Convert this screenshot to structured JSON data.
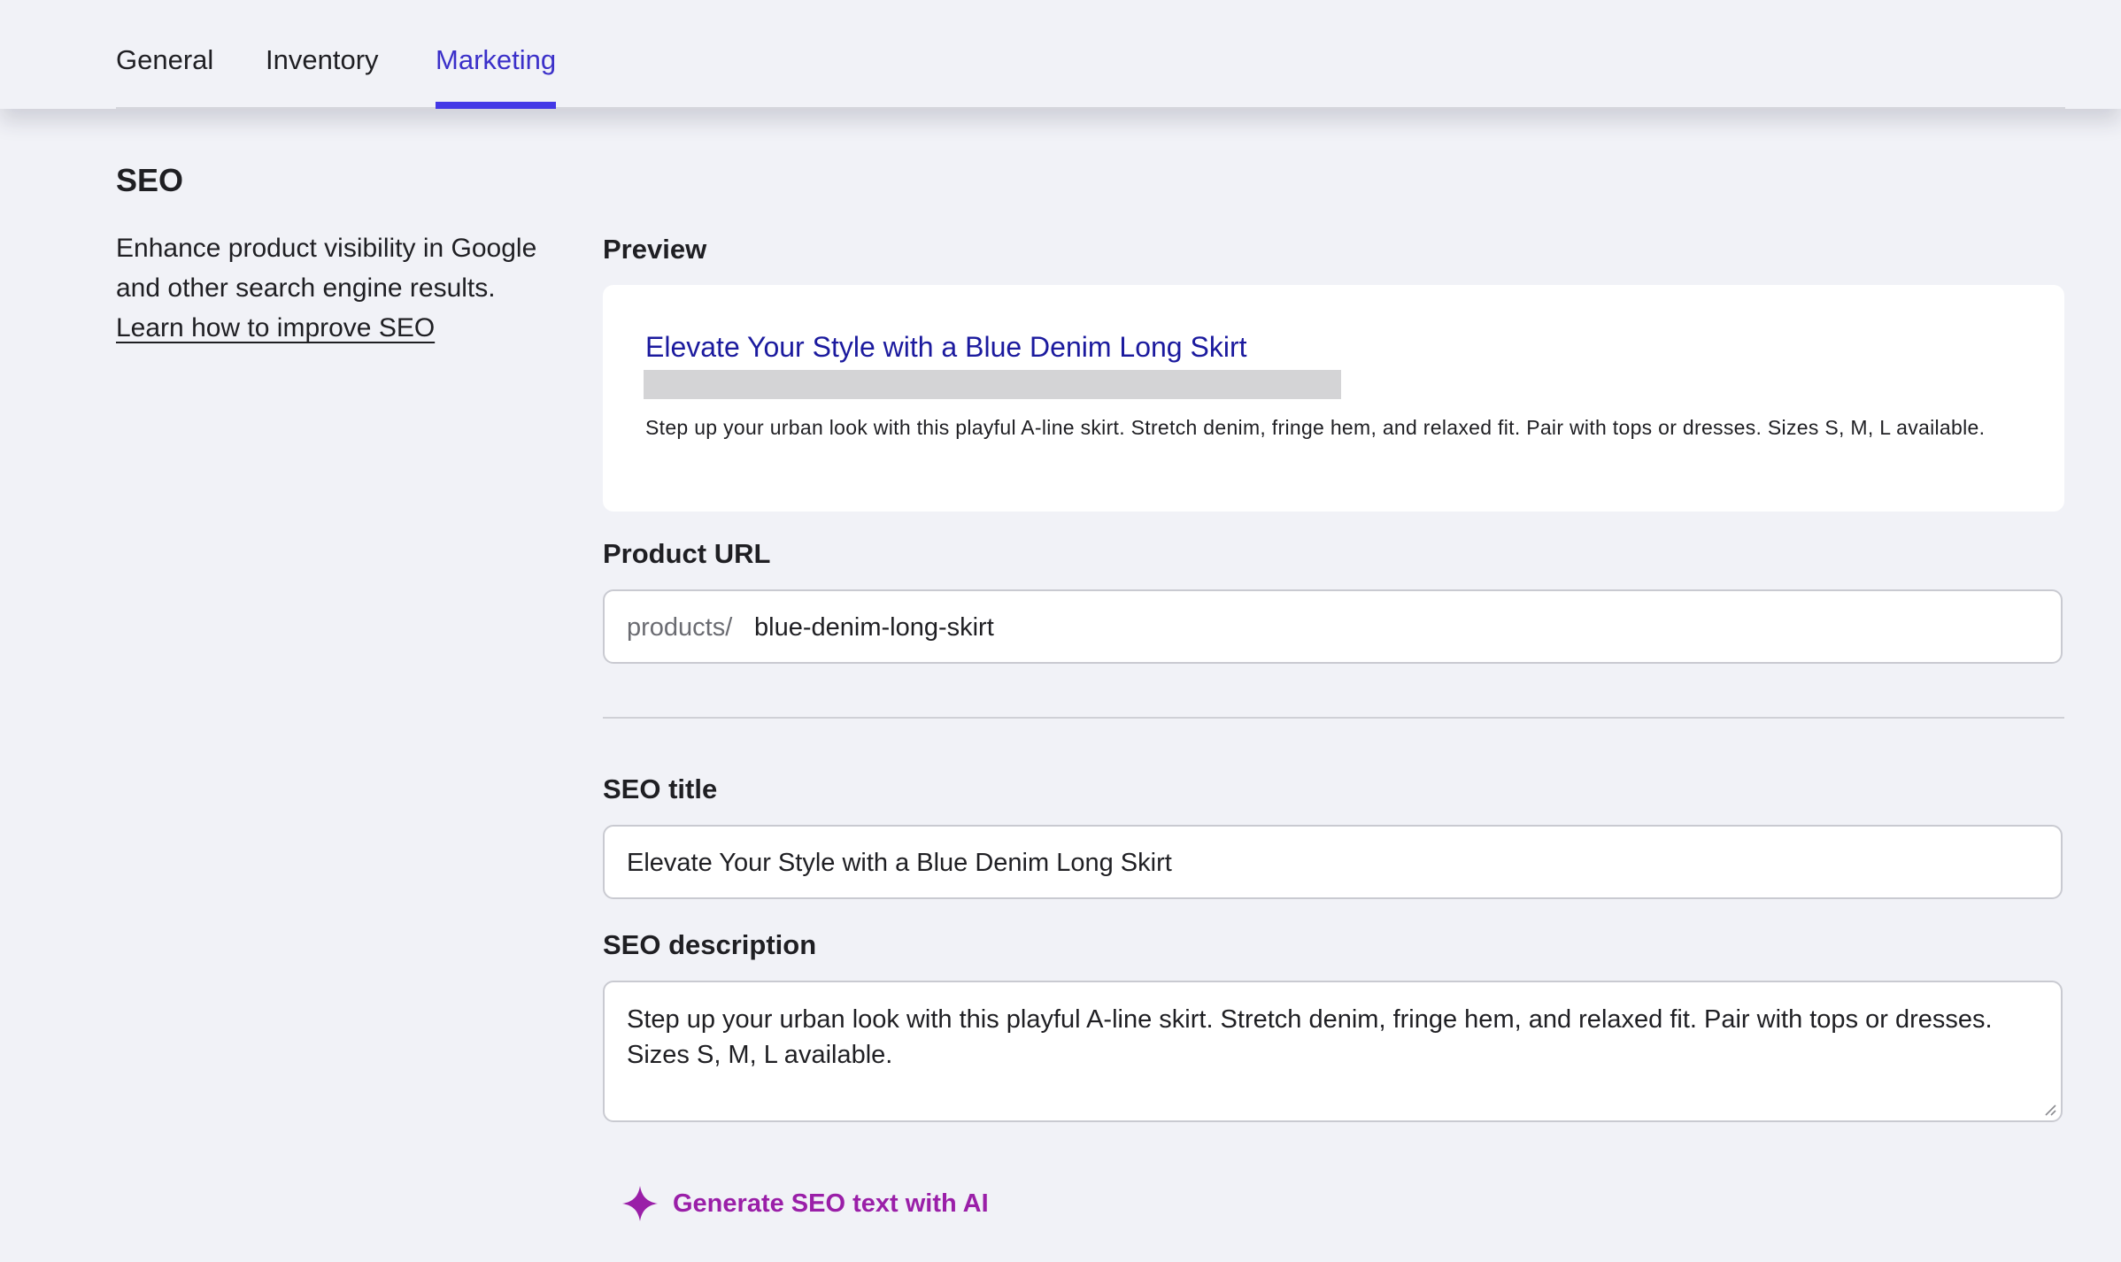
{
  "tabs": [
    {
      "label": "General"
    },
    {
      "label": "Inventory"
    },
    {
      "label": "Marketing",
      "active": true
    }
  ],
  "seo": {
    "title": "SEO",
    "description": "Enhance product visibility in Google and other search engine results.",
    "learn_link": "Learn how to improve SEO"
  },
  "preview": {
    "label": "Preview",
    "title": "Elevate Your Style with a Blue Denim Long Skirt",
    "description": "Step up your urban look with this playful A-line skirt. Stretch denim, fringe hem, and relaxed fit. Pair with tops or dresses. Sizes S, M, L available."
  },
  "product_url": {
    "label": "Product URL",
    "prefix": "products/",
    "value": "blue-denim-long-skirt"
  },
  "seo_title": {
    "label": "SEO title",
    "value": "Elevate Your Style with a Blue Denim Long Skirt"
  },
  "seo_description": {
    "label": "SEO description",
    "value": "Step up your urban look with this playful A-line skirt. Stretch denim, fringe hem, and relaxed fit. Pair with tops or dresses. Sizes S, M, L available."
  },
  "ai_button": {
    "label": "Generate SEO text with AI",
    "icon": "sparkle-icon"
  },
  "colors": {
    "accent": "#4338e6",
    "link_title": "#1b1a9e",
    "ai": "#9a1fa8",
    "background": "#f1f2f7"
  }
}
